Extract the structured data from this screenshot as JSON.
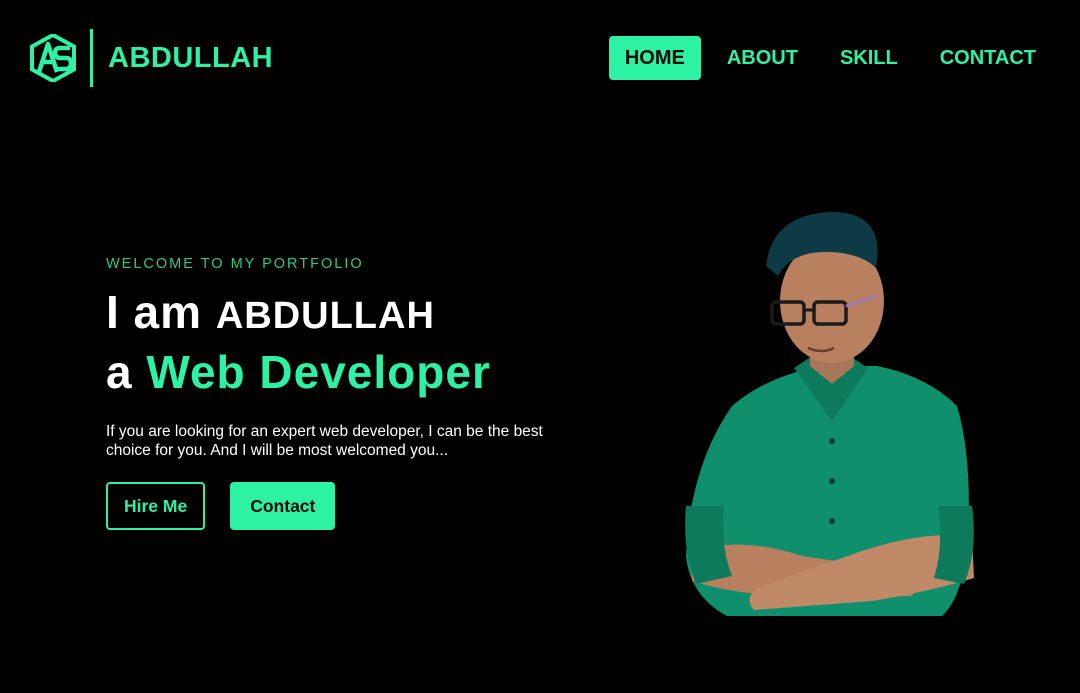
{
  "brand": {
    "logo_icon": "as-monogram-logo",
    "name": "ABDULLAH",
    "accent_color": "#2ef2a3",
    "background_color": "#000000"
  },
  "nav": {
    "items": [
      {
        "label": "HOME",
        "active": true
      },
      {
        "label": "ABOUT",
        "active": false
      },
      {
        "label": "SKILL",
        "active": false
      },
      {
        "label": "CONTACT",
        "active": false
      }
    ]
  },
  "hero": {
    "eyebrow": "WELCOME TO MY PORTFOLIO",
    "line1_prefix": "I am",
    "line1_name": "ABDULLAH",
    "line2_prefix": "a",
    "line2_role": "Web Developer",
    "intro": "If you are looking for an expert web developer, I can be the best choice for you. And I will be most welcomed you...",
    "buttons": {
      "hire_label": "Hire Me",
      "contact_label": "Contact"
    }
  },
  "portrait": {
    "icon": "person-portrait-image"
  }
}
